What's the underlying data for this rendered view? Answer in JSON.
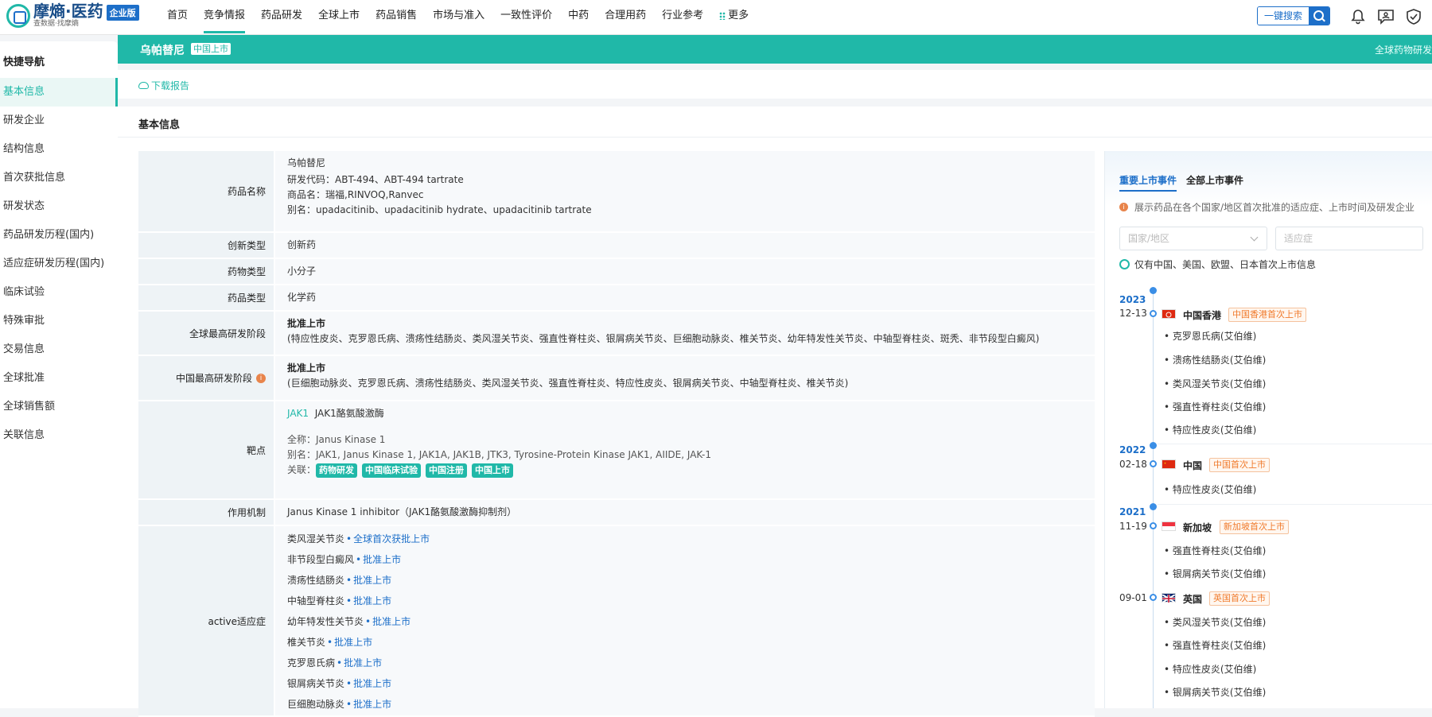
{
  "header": {
    "logo_name": "摩熵·医药",
    "logo_sub": "查数据·找摩熵",
    "edition": "企业版",
    "nav": [
      "首页",
      "竞争情报",
      "药品研发",
      "全球上市",
      "药品销售",
      "市场与准入",
      "一致性评价",
      "中药",
      "合理用药",
      "行业参考",
      "更多"
    ],
    "search_label": "一键搜索"
  },
  "banner": {
    "drug_name": "乌帕替尼",
    "status_tag": "中国上市",
    "right_text": "全球药物研发"
  },
  "sidebar": {
    "title": "快捷导航",
    "items": [
      "基本信息",
      "研发企业",
      "结构信息",
      "首次获批信息",
      "研发状态",
      "药品研发历程(国内)",
      "适应症研发历程(国内)",
      "临床试验",
      "特殊审批",
      "交易信息",
      "全球批准",
      "全球销售额",
      "关联信息"
    ]
  },
  "toolbar": {
    "download": "下载报告"
  },
  "section": {
    "title": "基本信息"
  },
  "info": {
    "name_label": "药品名称",
    "name_main": "乌帕替尼",
    "name_code": "研发代码：ABT-494、ABT-494 tartrate",
    "name_trade": "商品名：瑞福,RINVOQ,Ranvec",
    "name_alias": "别名：upadacitinib、upadacitinib hydrate、upadacitinib tartrate",
    "innov_label": "创新类型",
    "innov_value": "创新药",
    "drugtype_label": "药物类型",
    "drugtype_value": "小分子",
    "category_label": "药品类型",
    "category_value": "化学药",
    "global_label": "全球最高研发阶段",
    "global_stage": "批准上市",
    "global_ind": "(特应性皮炎、克罗恩氏病、溃疡性结肠炎、类风湿关节炎、强直性脊柱炎、银屑病关节炎、巨细胞动脉炎、椎关节炎、幼年特发性关节炎、中轴型脊柱炎、斑秃、非节段型白癜风)",
    "china_label": "中国最高研发阶段",
    "china_stage": "批准上市",
    "china_ind": "(巨细胞动脉炎、克罗恩氏病、溃疡性结肠炎、类风湿关节炎、强直性脊柱炎、特应性皮炎、银屑病关节炎、中轴型脊柱炎、椎关节炎)",
    "target_label": "靶点",
    "target_code": "JAK1",
    "target_name": "JAK1酪氨酸激酶",
    "target_full": "全称：Janus Kinase 1",
    "target_alias": "别名：JAK1, Janus Kinase 1, JAK1A, JAK1B, JTK3, Tyrosine-Protein Kinase JAK1, AIIDE, JAK-1",
    "target_rel": "关联：",
    "target_pills": [
      "药物研发",
      "中国临床试验",
      "中国注册",
      "中国上市"
    ],
    "moa_label": "作用机制",
    "moa_value": "Janus Kinase 1 inhibitor（JAK1酪氨酸激酶抑制剂）",
    "active_label": "active适应症",
    "active": [
      {
        "name": "类风湿关节炎",
        "status": "全球首次获批上市"
      },
      {
        "name": "非节段型白癜风",
        "status": "批准上市"
      },
      {
        "name": "溃疡性结肠炎",
        "status": "批准上市"
      },
      {
        "name": "中轴型脊柱炎",
        "status": "批准上市"
      },
      {
        "name": "幼年特发性关节炎",
        "status": "批准上市"
      },
      {
        "name": "椎关节炎",
        "status": "批准上市"
      },
      {
        "name": "克罗恩氏病",
        "status": "批准上市"
      },
      {
        "name": "银屑病关节炎",
        "status": "批准上市"
      },
      {
        "name": "巨细胞动脉炎",
        "status": "批准上市"
      }
    ]
  },
  "side": {
    "tab_major": "重要上市事件",
    "tab_all": "全部上市事件",
    "note": "展示药品在各个国家/地区首次批准的适应症、上市时间及研发企业",
    "country_placeholder": "国家/地区",
    "indication_placeholder": "适应症",
    "radio_label": "仅有中国、美国、欧盟、日本首次上市信息",
    "events": [
      {
        "year": "2023",
        "date": "12-13",
        "country": "中国香港",
        "tag": "中国香港首次上市",
        "inds": [
          "克罗恩氏病(艾伯维)",
          "溃疡性结肠炎(艾伯维)",
          "类风湿关节炎(艾伯维)",
          "强直性脊柱炎(艾伯维)",
          "特应性皮炎(艾伯维)"
        ]
      },
      {
        "year": "2022",
        "date": "02-18",
        "country": "中国",
        "tag": "中国首次上市",
        "inds": [
          "特应性皮炎(艾伯维)"
        ]
      },
      {
        "year": "2021",
        "date": "11-19",
        "country": "新加坡",
        "tag": "新加坡首次上市",
        "inds": [
          "强直性脊柱炎(艾伯维)",
          "银屑病关节炎(艾伯维)"
        ]
      },
      {
        "year": "",
        "date": "09-01",
        "country": "英国",
        "tag": "英国首次上市",
        "inds": [
          "类风湿关节炎(艾伯维)",
          "强直性脊柱炎(艾伯维)",
          "特应性皮炎(艾伯维)",
          "银屑病关节炎(艾伯维)"
        ]
      }
    ]
  },
  "colors": {
    "accent": "#20b8a8",
    "link": "#1d6fc9",
    "tag": "#f07a2b"
  }
}
